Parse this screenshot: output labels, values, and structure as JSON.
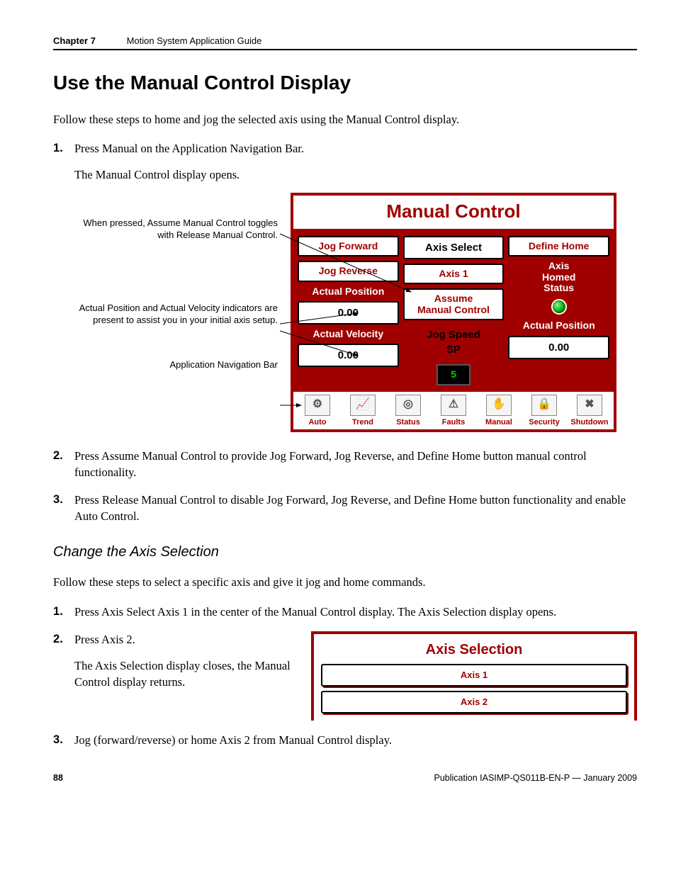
{
  "header": {
    "chapter": "Chapter 7",
    "title": "Motion System Application Guide"
  },
  "h1": "Use the Manual Control Display",
  "intro": "Follow these steps to home and jog the selected axis using the Manual Control display.",
  "step1": {
    "text": "Press Manual on the Application Navigation Bar.",
    "sub": "The Manual Control display opens."
  },
  "callouts": {
    "c1": "When pressed, Assume Manual Control toggles with Release Manual Control.",
    "c2": "Actual Position and Actual Velocity indicators are present to assist you in your initial axis setup.",
    "c3": "Application Navigation Bar"
  },
  "hmi": {
    "title": "Manual Control",
    "jog_forward": "Jog Forward",
    "jog_reverse": "Jog Reverse",
    "actual_position_lbl": "Actual Position",
    "actual_position_val": "0.00",
    "actual_velocity_lbl": "Actual Velocity",
    "actual_velocity_val": "0.00",
    "axis_select_lbl": "Axis Select",
    "axis_select_val": "Axis 1",
    "assume_btn_l1": "Assume",
    "assume_btn_l2": "Manual Control",
    "jog_speed_lbl1": "Jog Speed",
    "jog_speed_lbl2": "SP",
    "jog_speed_val": "5",
    "define_home": "Define Home",
    "axis_homed_l1": "Axis",
    "axis_homed_l2": "Homed",
    "axis_homed_l3": "Status",
    "right_actual_pos_lbl": "Actual Position",
    "right_actual_pos_val": "0.00",
    "nav": [
      "Auto",
      "Trend",
      "Status",
      "Faults",
      "Manual",
      "Security",
      "Shutdown"
    ],
    "nav_icons": [
      "⚙",
      "📈",
      "◎",
      "⚠",
      "✋",
      "🔒",
      "✖"
    ]
  },
  "step2": "Press Assume Manual Control to provide Jog Forward, Jog Reverse, and Define Home button manual control functionality.",
  "step3": "Press Release Manual Control to disable Jog Forward, Jog Reverse, and Define Home button functionality and enable Auto Control.",
  "h2": "Change the Axis Selection",
  "intro2": "Follow these steps to select a specific axis and give it jog and home commands.",
  "b_step1": "Press Axis Select Axis 1 in the center of the Manual Control display. The Axis Selection display opens.",
  "b_step2": {
    "text": "Press Axis 2.",
    "sub": "The Axis Selection display closes, the Manual Control display returns."
  },
  "axis_panel": {
    "title": "Axis Selection",
    "axis1": "Axis 1",
    "axis2": "Axis 2"
  },
  "b_step3": "Jog (forward/reverse) or home Axis 2 from Manual Control display.",
  "footer": {
    "page": "88",
    "pub": "Publication IASIMP-QS011B-EN-P — January 2009"
  }
}
